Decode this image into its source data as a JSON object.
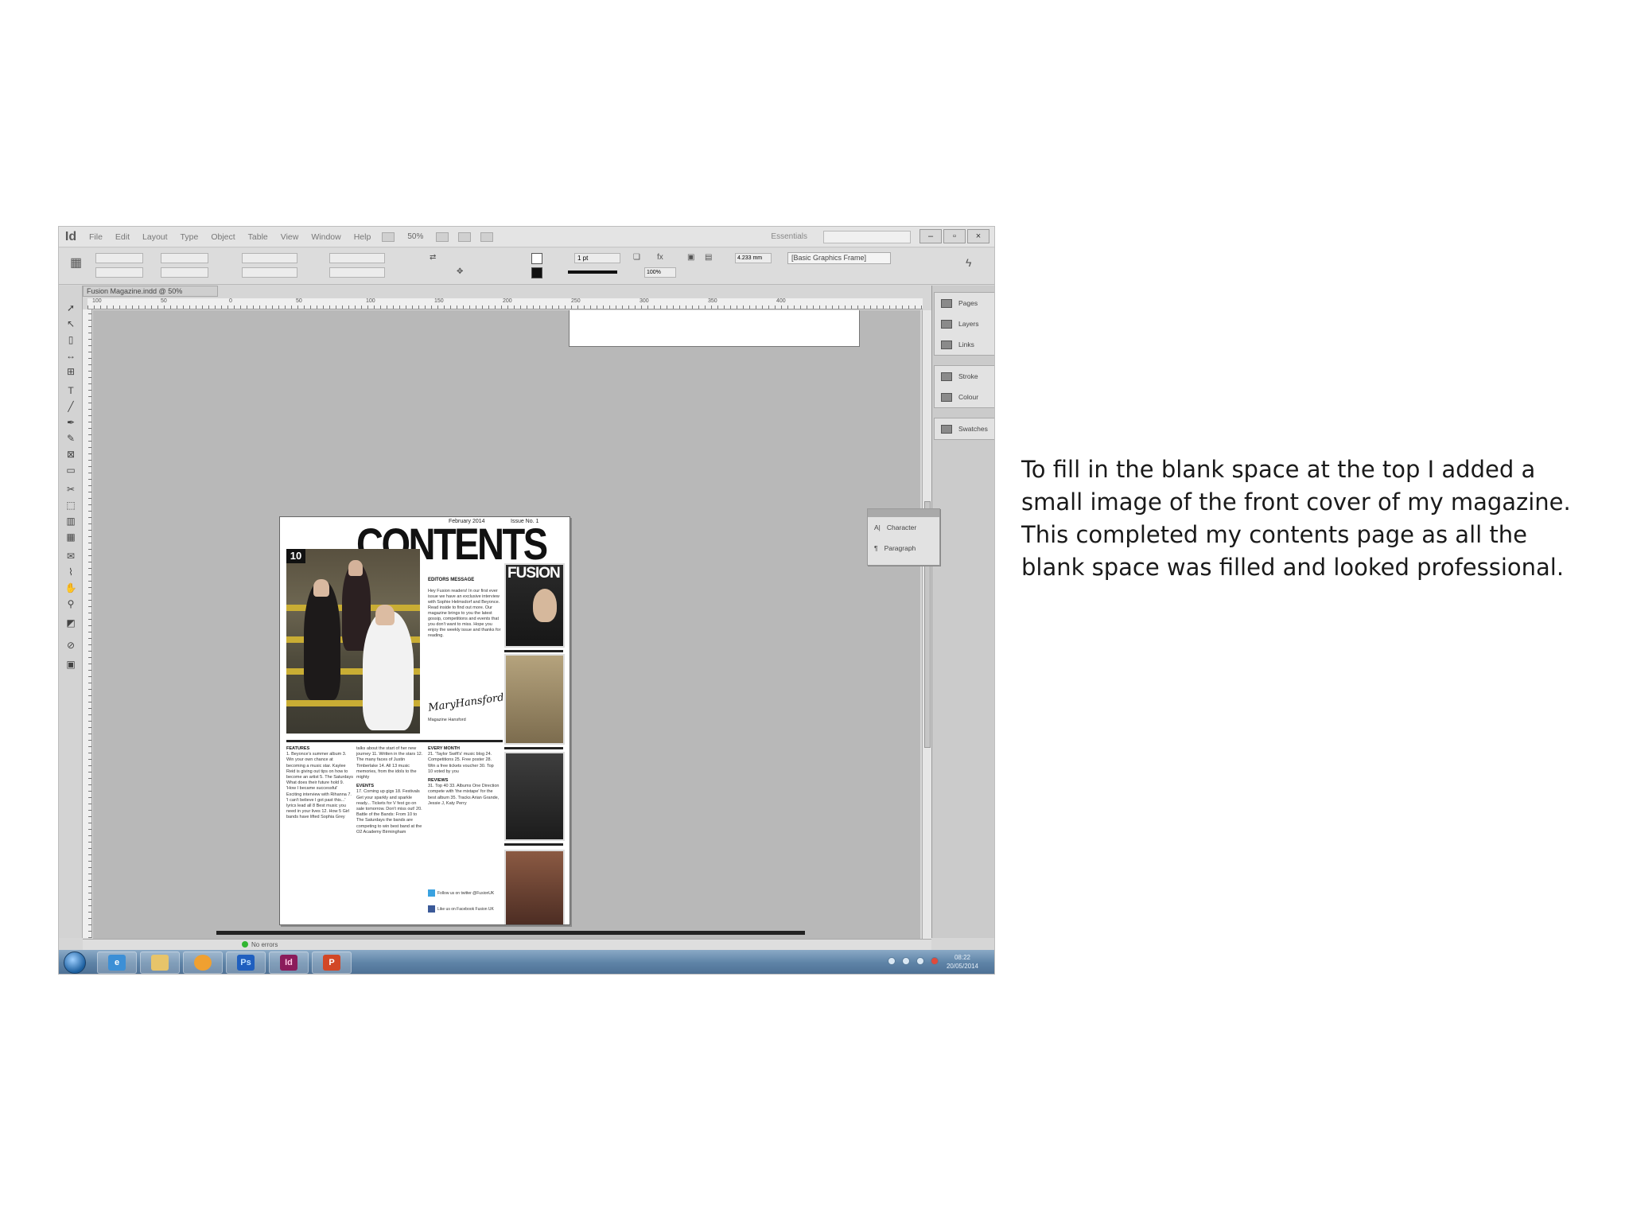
{
  "caption": {
    "line1": "To fill in the blank space at the top I added a",
    "line2": "small image of the front cover of my magazine.",
    "line3": "This completed my contents page as all the",
    "line4": "blank space was filled and looked professional."
  },
  "app": {
    "logo": "Id",
    "menu": [
      "File",
      "Edit",
      "Layout",
      "Type",
      "Object",
      "Table",
      "View",
      "Window",
      "Help"
    ],
    "zoom": "50%",
    "workspace": "Essentials",
    "document_tab": "Fusion Magazine.indd @ 50%",
    "stroke_weight": "1 pt",
    "reference_size": "4.233 mm",
    "frame_style": "[Basic Graphics Frame]",
    "scale": "100%",
    "preflight": "No errors"
  },
  "ruler": {
    "marks": [
      "100",
      "50",
      "0",
      "50",
      "100",
      "150",
      "200",
      "250",
      "300",
      "350",
      "400"
    ]
  },
  "panels": {
    "group1": [
      "Pages",
      "Layers",
      "Links"
    ],
    "group2": [
      "Stroke",
      "Colour"
    ],
    "group3": [
      "Swatches"
    ],
    "floating": [
      "Character",
      "Paragraph"
    ]
  },
  "magazine": {
    "date": "February 2014",
    "issue": "Issue No. 1",
    "title": "CONTENTS",
    "badge": "10",
    "cover_word": "FUSION",
    "editor_heading": "EDITORS MESSAGE",
    "editor_text": "Hey Fusion readers! In our first ever issue we have an exclusive interview with Sophie Helmsdorf and Beyonce. Read inside to find out more. Our magazine brings to you the latest gossip, competitions and events that you don't want to miss. Hope you enjoy the weekly issue and thanks for reading.",
    "signature": "MaryHansford",
    "signature_name": "Magazine Hansford",
    "features_heading": "FEATURES",
    "features_text": "1. Beyonce's summer album 3. Win your own chance at becoming a music star. Kaylee Reid is giving out tips on how to become an artist 5. The Saturdays What does their future hold 9. 'How I became successful' Exciting interview with Rihanna 7. 'I can't believe I got past this...' lyrics lead all 8 Best music you need in your lives 12. How 5 Girl bands have lifted Sophia Grey",
    "col2_text": "talks about the start of her new journey 11. Written in the stars 12. The many faces of Justin Timberlake 14. All 13 music memories, from the idols to the mighty",
    "events_heading": "EVENTS",
    "events_text": "17. Coming up gigs 18. Festivals Get your sparkly and sparkle ready... Tickets for V fest go on sale tomorrow. Don't miss out! 20. Battle of the Bands: From 10 to The Saturdays the bands are competing to win best band at the O2 Academy Birmingham",
    "every_month_heading": "EVERY MONTH",
    "every_month_text": "21. 'Taylor Swift's' music blog 24. Competitions 25. Free poster 28. Win a free tickets voucher 30. Top 10 voted by you",
    "reviews_heading": "REVIEWS",
    "reviews_text": "31. Top 40 33. Albums One Direction compete with 'the mixtape' for the best album 35. Tracks Arian Grande, Jessie J, Katy Perry",
    "twitter": "Follow us on twitter @FusionUK",
    "facebook": "Like us on Facebook Fusion UK"
  },
  "taskbar": {
    "apps": [
      "Ps",
      "Id",
      "P"
    ],
    "time": "08:22",
    "date": "20/05/2014"
  },
  "colors": {
    "pasteboard": "#b8b8b8",
    "taskbar": "#5f84a7",
    "photoshop": "#1f5fbf",
    "indesign": "#8b1c5b",
    "powerpoint": "#d24726"
  }
}
